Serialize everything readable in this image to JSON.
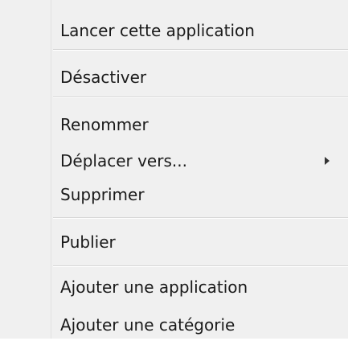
{
  "menu": {
    "items": [
      {
        "label": "Lancer cette application"
      },
      {
        "label": "Désactiver"
      },
      {
        "label": "Renommer"
      },
      {
        "label": "Déplacer vers..."
      },
      {
        "label": "Supprimer"
      },
      {
        "label": "Publier"
      },
      {
        "label": "Ajouter une application"
      },
      {
        "label": "Ajouter une catégorie"
      }
    ]
  }
}
